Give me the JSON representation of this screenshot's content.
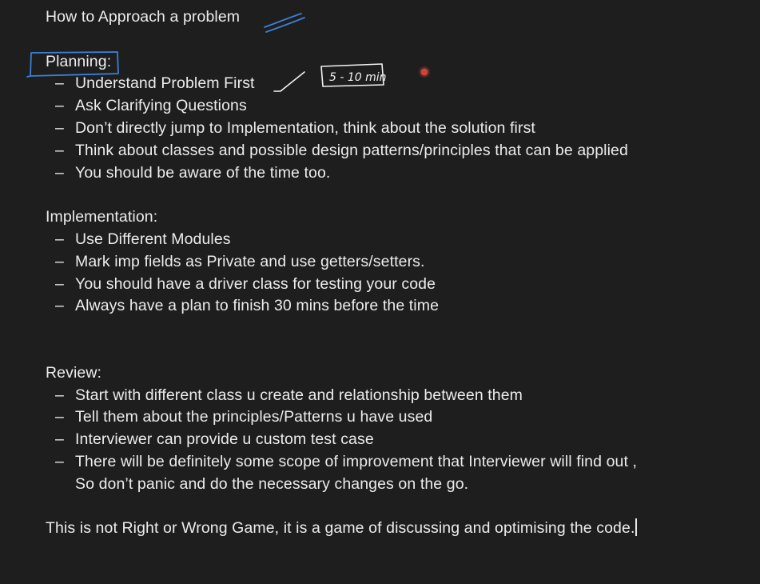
{
  "note": {
    "title": "How to Approach a problem",
    "planning": {
      "heading": "Planning:",
      "items": [
        "Understand Problem First",
        "Ask Clarifying Questions",
        "Don’t directly jump to Implementation, think about the solution first",
        "Think about classes and possible design patterns/principles that can be applied",
        "You should be aware of the time too."
      ]
    },
    "implementation": {
      "heading": "Implementation:",
      "items": [
        "Use Different Modules",
        "Mark imp fields as Private and use getters/setters.",
        "You should have a driver class for testing your code",
        "Always have a plan to finish 30 mins before the time"
      ]
    },
    "review": {
      "heading": "Review:",
      "items": [
        "Start with different class u create and relationship between them",
        "Tell them about the principles/Patterns u have used",
        "Interviewer can provide u custom test case",
        "There will be definitely some scope of improvement that Interviewer will find out ,"
      ],
      "continuation": "So don’t panic and do the necessary changes on the go."
    },
    "closing": "This is not Right or Wrong Game, it is a game of discussing and optimising the code.",
    "dash": "–"
  },
  "annotations": {
    "handwritten_time": "5 - 10 min",
    "ink_color": "#3b7fd4",
    "pointer_color": "#e0463c"
  }
}
